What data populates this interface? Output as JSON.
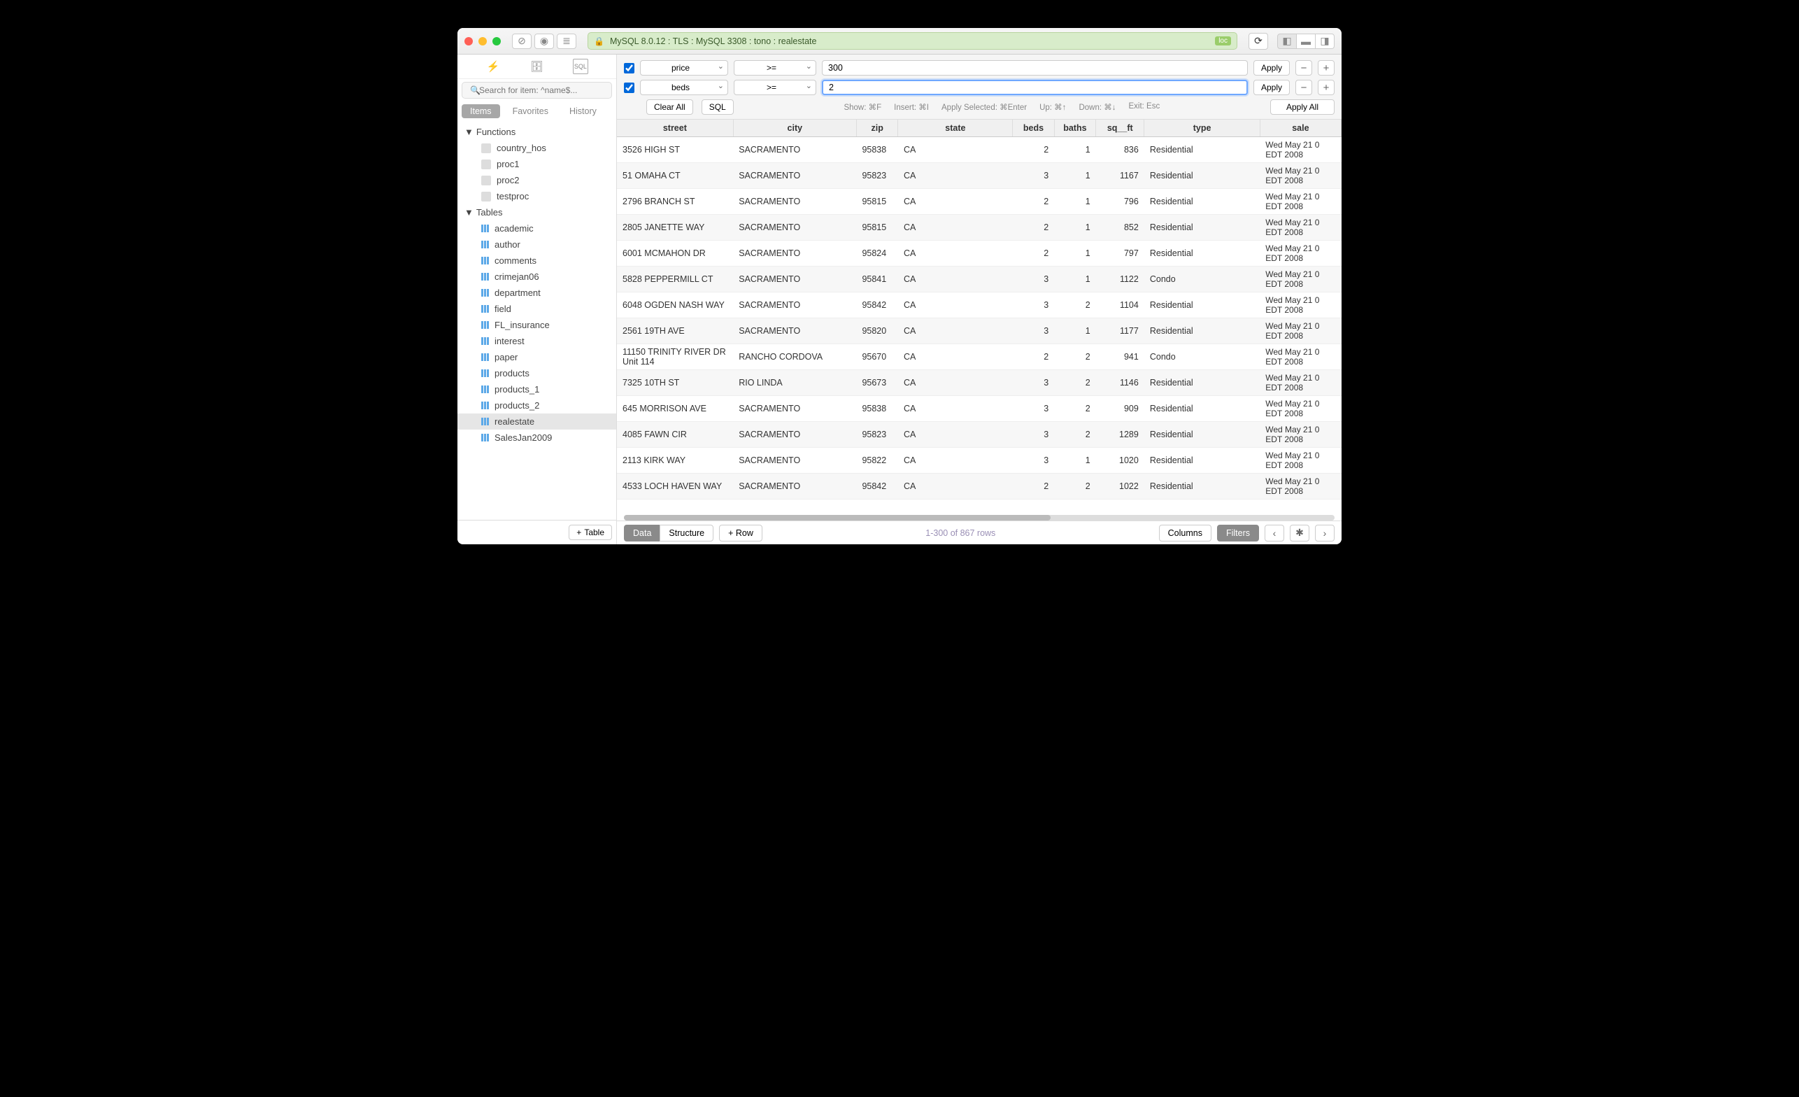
{
  "titlebar": {
    "conn": "MySQL 8.0.12 : TLS : MySQL 3308 : tono : realestate",
    "loc": "loc"
  },
  "sidebar": {
    "search_placeholder": "Search for item: ^name$...",
    "tabs": {
      "items": "Items",
      "favorites": "Favorites",
      "history": "History"
    },
    "functions_label": "Functions",
    "functions": [
      "country_hos",
      "proc1",
      "proc2",
      "testproc"
    ],
    "tables_label": "Tables",
    "tables": [
      "academic",
      "author",
      "comments",
      "crimejan06",
      "department",
      "field",
      "FL_insurance",
      "interest",
      "paper",
      "products",
      "products_1",
      "products_2",
      "realestate",
      "SalesJan2009"
    ],
    "selected_table": "realestate",
    "add_table": "Table"
  },
  "filters": {
    "rows": [
      {
        "enabled": true,
        "column": "price",
        "op": ">=",
        "value": "300",
        "focused": false
      },
      {
        "enabled": true,
        "column": "beds",
        "op": ">=",
        "value": "2",
        "focused": true
      }
    ],
    "apply": "Apply",
    "clear_all": "Clear All",
    "sql": "SQL",
    "apply_all": "Apply All",
    "hints": {
      "show": "Show: ⌘F",
      "insert": "Insert: ⌘I",
      "apply_sel": "Apply Selected: ⌘Enter",
      "up": "Up: ⌘↑",
      "down": "Down: ⌘↓",
      "exit": "Exit: Esc"
    }
  },
  "columns": [
    "street",
    "city",
    "zip",
    "state",
    "beds",
    "baths",
    "sq__ft",
    "type",
    "sale"
  ],
  "rows": [
    {
      "street": "3526 HIGH ST",
      "city": "SACRAMENTO",
      "zip": "95838",
      "state": "CA",
      "beds": 2,
      "baths": 1,
      "sq__ft": 836,
      "type": "Residential",
      "sale": "Wed May 21 0 EDT 2008"
    },
    {
      "street": "51 OMAHA CT",
      "city": "SACRAMENTO",
      "zip": "95823",
      "state": "CA",
      "beds": 3,
      "baths": 1,
      "sq__ft": 1167,
      "type": "Residential",
      "sale": "Wed May 21 0 EDT 2008"
    },
    {
      "street": "2796 BRANCH ST",
      "city": "SACRAMENTO",
      "zip": "95815",
      "state": "CA",
      "beds": 2,
      "baths": 1,
      "sq__ft": 796,
      "type": "Residential",
      "sale": "Wed May 21 0 EDT 2008"
    },
    {
      "street": "2805 JANETTE WAY",
      "city": "SACRAMENTO",
      "zip": "95815",
      "state": "CA",
      "beds": 2,
      "baths": 1,
      "sq__ft": 852,
      "type": "Residential",
      "sale": "Wed May 21 0 EDT 2008"
    },
    {
      "street": "6001 MCMAHON DR",
      "city": "SACRAMENTO",
      "zip": "95824",
      "state": "CA",
      "beds": 2,
      "baths": 1,
      "sq__ft": 797,
      "type": "Residential",
      "sale": "Wed May 21 0 EDT 2008"
    },
    {
      "street": "5828 PEPPERMILL CT",
      "city": "SACRAMENTO",
      "zip": "95841",
      "state": "CA",
      "beds": 3,
      "baths": 1,
      "sq__ft": 1122,
      "type": "Condo",
      "sale": "Wed May 21 0 EDT 2008"
    },
    {
      "street": "6048 OGDEN NASH WAY",
      "city": "SACRAMENTO",
      "zip": "95842",
      "state": "CA",
      "beds": 3,
      "baths": 2,
      "sq__ft": 1104,
      "type": "Residential",
      "sale": "Wed May 21 0 EDT 2008"
    },
    {
      "street": "2561 19TH AVE",
      "city": "SACRAMENTO",
      "zip": "95820",
      "state": "CA",
      "beds": 3,
      "baths": 1,
      "sq__ft": 1177,
      "type": "Residential",
      "sale": "Wed May 21 0 EDT 2008"
    },
    {
      "street": "11150 TRINITY RIVER DR Unit 114",
      "city": "RANCHO CORDOVA",
      "zip": "95670",
      "state": "CA",
      "beds": 2,
      "baths": 2,
      "sq__ft": 941,
      "type": "Condo",
      "sale": "Wed May 21 0 EDT 2008"
    },
    {
      "street": "7325 10TH ST",
      "city": "RIO LINDA",
      "zip": "95673",
      "state": "CA",
      "beds": 3,
      "baths": 2,
      "sq__ft": 1146,
      "type": "Residential",
      "sale": "Wed May 21 0 EDT 2008"
    },
    {
      "street": "645 MORRISON AVE",
      "city": "SACRAMENTO",
      "zip": "95838",
      "state": "CA",
      "beds": 3,
      "baths": 2,
      "sq__ft": 909,
      "type": "Residential",
      "sale": "Wed May 21 0 EDT 2008"
    },
    {
      "street": "4085 FAWN CIR",
      "city": "SACRAMENTO",
      "zip": "95823",
      "state": "CA",
      "beds": 3,
      "baths": 2,
      "sq__ft": 1289,
      "type": "Residential",
      "sale": "Wed May 21 0 EDT 2008"
    },
    {
      "street": "2113 KIRK WAY",
      "city": "SACRAMENTO",
      "zip": "95822",
      "state": "CA",
      "beds": 3,
      "baths": 1,
      "sq__ft": 1020,
      "type": "Residential",
      "sale": "Wed May 21 0 EDT 2008"
    },
    {
      "street": "4533 LOCH HAVEN WAY",
      "city": "SACRAMENTO",
      "zip": "95842",
      "state": "CA",
      "beds": 2,
      "baths": 2,
      "sq__ft": 1022,
      "type": "Residential",
      "sale": "Wed May 21 0 EDT 2008"
    }
  ],
  "footer": {
    "data": "Data",
    "structure": "Structure",
    "row": "Row",
    "rows_info": "1-300 of 867 rows",
    "columns": "Columns",
    "filters": "Filters"
  }
}
